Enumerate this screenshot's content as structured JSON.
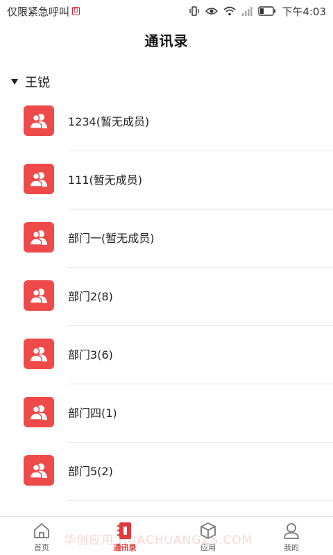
{
  "status_bar": {
    "carrier_text": "仅限紧急呼叫",
    "hd_badge": "D",
    "battery_level": 0.3,
    "time": "下午4:03",
    "icons": [
      "vibrate-icon",
      "eye-icon",
      "wifi-icon",
      "signal-icon",
      "battery-icon"
    ]
  },
  "header": {
    "title": "通讯录"
  },
  "group": {
    "name": "王锐",
    "expanded": true
  },
  "departments": [
    {
      "label": "1234(暂无成员)"
    },
    {
      "label": "111(暂无成员)"
    },
    {
      "label": "部门一(暂无成员)"
    },
    {
      "label": "部门2(8)"
    },
    {
      "label": "部门3(6)"
    },
    {
      "label": "部门四(1)"
    },
    {
      "label": "部门5(2)"
    }
  ],
  "tabs": [
    {
      "label": "首页",
      "icon": "home-icon",
      "active": false
    },
    {
      "label": "通讯录",
      "icon": "contacts-book-icon",
      "active": true
    },
    {
      "label": "应用",
      "icon": "cube-icon",
      "active": false
    },
    {
      "label": "我的",
      "icon": "user-icon",
      "active": false
    }
  ],
  "watermark": "华创应用 HUACHUANGZS.COM",
  "colors": {
    "accent": "#e03a3a",
    "avatar_bg": "#ef4a4a",
    "divider": "#e6e6e6"
  }
}
